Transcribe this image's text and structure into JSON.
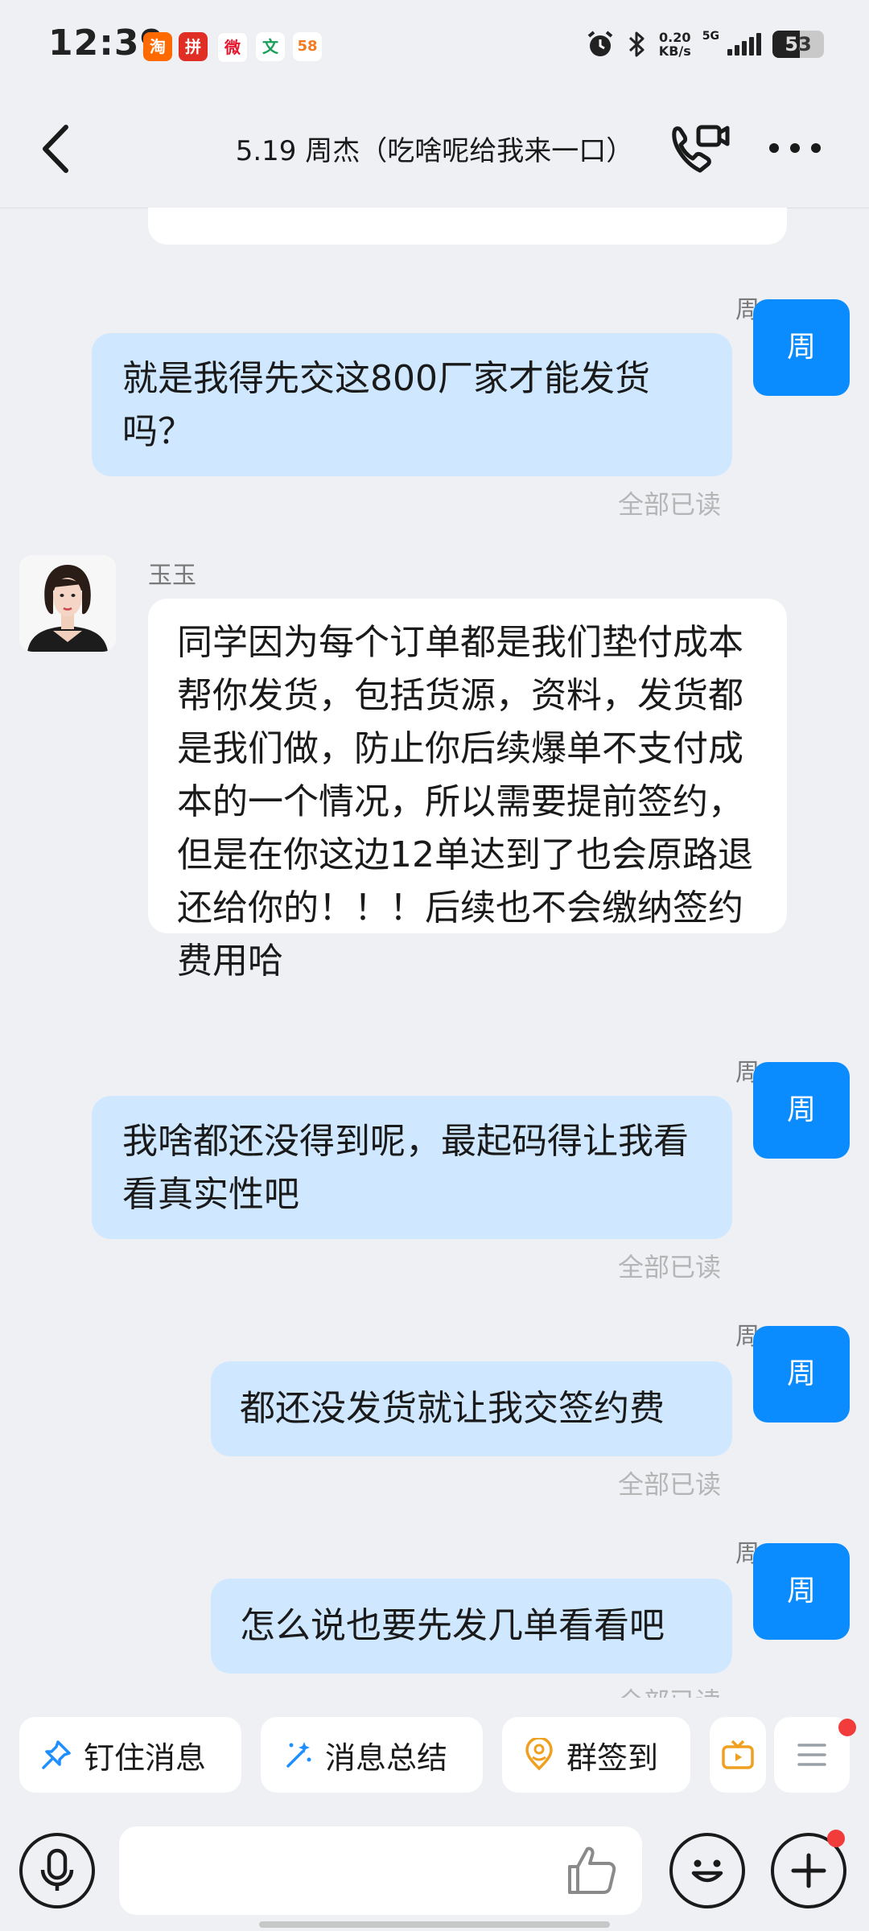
{
  "status_bar": {
    "time": "12:39",
    "net_speed_value": "0.20",
    "net_speed_unit": "KB/s",
    "network": "5G",
    "battery": "53",
    "apps": [
      "taobao-app",
      "pinduoduo-app",
      "weibo-app",
      "wenku-app",
      "58-app"
    ]
  },
  "header": {
    "title": "5.19 周杰（吃啥呢给我来一口）"
  },
  "me_avatar_label": "周",
  "messages": [
    {
      "sender": "周",
      "text": "就是我得先交这800厂家才能发货吗？",
      "status": "全部已读"
    },
    {
      "sender": "玉玉",
      "text": "同学因为每个订单都是我们垫付成本帮你发货，包括货源，资料，发货都是我们做，防止你后续爆单不支付成本的一个情况，所以需要提前签约，但是在你这边12单达到了也会原路退还给你的！！！后续也不会缴纳签约费用哈"
    },
    {
      "sender": "周",
      "text": "我啥都还没得到呢，最起码得让我看看真实性吧",
      "status": "全部已读"
    },
    {
      "sender": "周",
      "text": "都还没发货就让我交签约费",
      "status": "全部已读"
    },
    {
      "sender": "周",
      "text": "怎么说也要先发几单看看吧",
      "status": "全部已读"
    }
  ],
  "quick_actions": {
    "pin": "钉住消息",
    "summary": "消息总结",
    "checkin": "群签到"
  },
  "input": {
    "placeholder": ""
  },
  "colors": {
    "accent": "#0a8cff",
    "my_bubble": "#cfe8ff",
    "background": "#eff0f4",
    "badge": "#f23b3b"
  }
}
